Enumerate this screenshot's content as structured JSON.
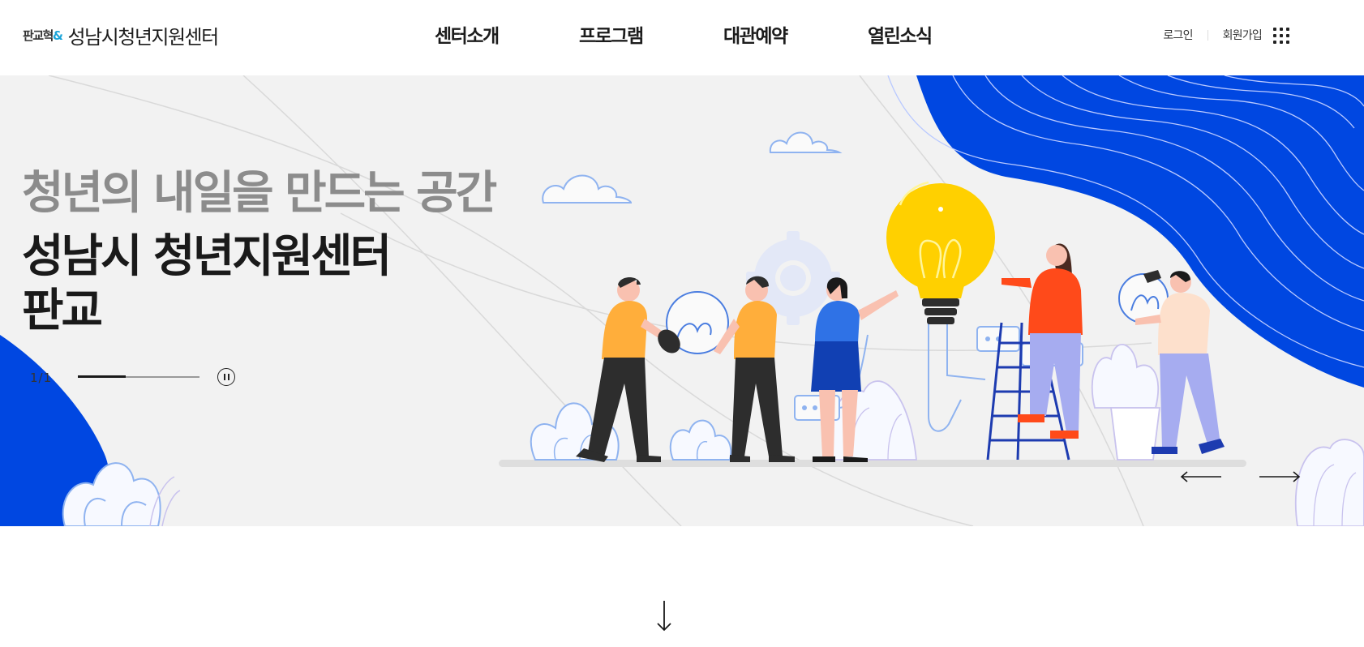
{
  "header": {
    "logo_mark": "판교혁",
    "logo_amp": "&",
    "logo_text": "성남시청년지원센터",
    "nav": [
      {
        "label": "센터소개"
      },
      {
        "label": "프로그램"
      },
      {
        "label": "대관예약"
      },
      {
        "label": "열린소식"
      }
    ],
    "util": {
      "login": "로그인",
      "signup": "회원가입"
    },
    "icons": {
      "all_menu": "grid-menu-icon"
    }
  },
  "hero": {
    "subtitle": "청년의 내일을 만드는 공간",
    "title_line1": "성남시 청년지원센터",
    "title_line2": "판교",
    "pager": "1/1",
    "progress": 0.39,
    "icons": {
      "pause": "pause-icon",
      "prev": "arrow-left-icon",
      "next": "arrow-right-icon"
    }
  },
  "scroll": {
    "icon": "arrow-down-icon"
  },
  "colors": {
    "accent_blue": "#0047e1",
    "hero_bg": "#f2f2f2",
    "bulb_yellow": "#ffd000",
    "text_dark": "#1a1a1a",
    "text_gray": "#8c8c8c"
  }
}
